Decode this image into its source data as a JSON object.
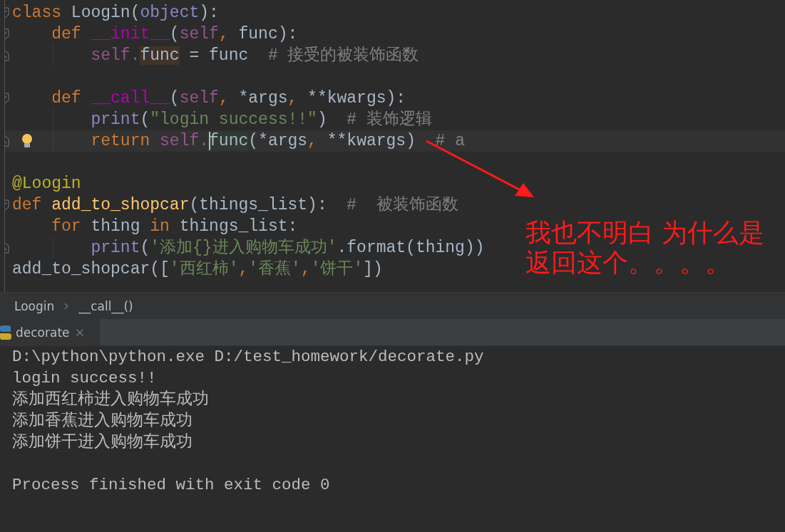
{
  "editor": {
    "blocks": [
      {
        "lines": [
          {
            "fold_start": true,
            "tokens": [
              {
                "kind": "keyword",
                "text": "class "
              },
              {
                "kind": "plain",
                "text": "Loogin("
              },
              {
                "kind": "builtin",
                "text": "object"
              },
              {
                "kind": "plain",
                "text": "):"
              }
            ]
          },
          {
            "fold_start": true,
            "tokens": [
              {
                "kind": "keyword",
                "text": "    def "
              },
              {
                "kind": "magic",
                "text": "__init__"
              },
              {
                "kind": "plain",
                "text": "("
              },
              {
                "kind": "self",
                "text": "self"
              },
              {
                "kind": "keyword",
                "text": ", "
              },
              {
                "kind": "plain",
                "text": "func):"
              }
            ]
          },
          {
            "fold_end": true,
            "tokens": [
              {
                "kind": "self",
                "text": "        self."
              },
              {
                "kind": "plain",
                "text": "func",
                "highlighted": true,
                "write": true
              },
              {
                "kind": "plain",
                "text": " = func  "
              },
              {
                "kind": "comment",
                "text": "# 接受的被装饰函数"
              }
            ]
          }
        ]
      },
      {
        "lines": [
          {
            "fold_start": true,
            "tokens": [
              {
                "kind": "keyword",
                "text": "    def "
              },
              {
                "kind": "magic",
                "text": "__call__"
              },
              {
                "kind": "plain",
                "text": "("
              },
              {
                "kind": "self",
                "text": "self"
              },
              {
                "kind": "keyword",
                "text": ", "
              },
              {
                "kind": "plain",
                "text": "*args"
              },
              {
                "kind": "keyword",
                "text": ", "
              },
              {
                "kind": "plain",
                "text": "**kwargs):"
              }
            ]
          },
          {
            "tokens": [
              {
                "kind": "builtin",
                "text": "        print"
              },
              {
                "kind": "plain",
                "text": "("
              },
              {
                "kind": "string",
                "text": "\"login success!!\""
              },
              {
                "kind": "plain",
                "text": ")  "
              },
              {
                "kind": "comment",
                "text": "# 装饰逻辑"
              }
            ]
          },
          {
            "fold_end": true,
            "current": true,
            "bulb": true,
            "tokens": [
              {
                "kind": "keyword",
                "text": "        return "
              },
              {
                "kind": "self",
                "text": "self."
              },
              {
                "kind": "plain",
                "text": "func",
                "highlighted": true,
                "caret": true
              },
              {
                "kind": "plain",
                "text": "(*args"
              },
              {
                "kind": "keyword",
                "text": ", "
              },
              {
                "kind": "plain",
                "text": "**kwargs)  "
              },
              {
                "kind": "comment",
                "text": "# a"
              }
            ]
          }
        ]
      },
      {
        "lines": [
          {
            "tokens": [
              {
                "kind": "decorator",
                "text": "@Loogin"
              }
            ]
          },
          {
            "fold_start": true,
            "tokens": [
              {
                "kind": "keyword",
                "text": "def "
              },
              {
                "kind": "funcdef",
                "text": "add_to_shopcar"
              },
              {
                "kind": "plain",
                "text": "(things_list):  "
              },
              {
                "kind": "comment",
                "text": "#  被装饰函数"
              }
            ]
          },
          {
            "tokens": [
              {
                "kind": "keyword",
                "text": "    for "
              },
              {
                "kind": "plain",
                "text": "thing "
              },
              {
                "kind": "keyword",
                "text": "in "
              },
              {
                "kind": "plain",
                "text": "things_list:"
              }
            ]
          },
          {
            "fold_end": true,
            "tokens": [
              {
                "kind": "builtin",
                "text": "        print"
              },
              {
                "kind": "plain",
                "text": "("
              },
              {
                "kind": "string",
                "text": "'添加{}进入购物车成功'"
              },
              {
                "kind": "plain",
                "text": ".format(thing))"
              }
            ]
          },
          {
            "tokens": [
              {
                "kind": "plain",
                "text": "add_to_shopcar(["
              },
              {
                "kind": "string",
                "text": "'西红柿'"
              },
              {
                "kind": "keyword",
                "text": ","
              },
              {
                "kind": "string",
                "text": "'香蕉'"
              },
              {
                "kind": "keyword",
                "text": ","
              },
              {
                "kind": "string",
                "text": "'饼干'"
              },
              {
                "kind": "plain",
                "text": "])"
              }
            ]
          }
        ]
      }
    ]
  },
  "breadcrumbs": [
    "Loogin",
    "__call__()"
  ],
  "run_tab": {
    "label": "decorate"
  },
  "console": {
    "lines": [
      "D:\\python\\python.exe D:/test_homework/decorate.py",
      "login success!!",
      "添加西红柿进入购物车成功",
      "添加香蕉进入购物车成功",
      "添加饼干进入购物车成功"
    ],
    "exit_message": "Process finished with exit code 0"
  },
  "annotation": {
    "lines": [
      "我也不明白 为什么是",
      "返回这个。。。。"
    ]
  }
}
